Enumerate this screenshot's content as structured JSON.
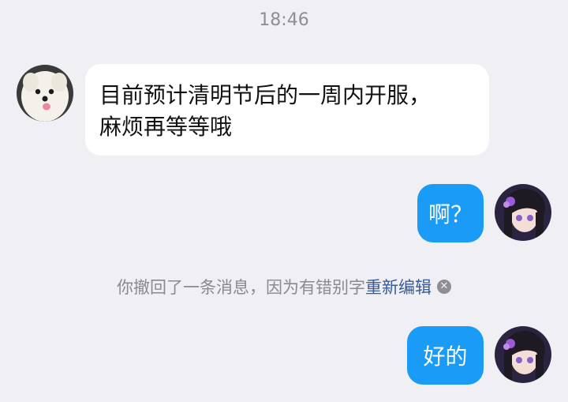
{
  "chat": {
    "timestamp": "18:46",
    "incoming_message": {
      "line1": "目前预计清明节后的一周内开服，",
      "line2": "麻烦再等等哦"
    },
    "outgoing_messages": [
      {
        "text": "啊？"
      },
      {
        "text": "好的"
      }
    ],
    "system_notice": {
      "text": "你撤回了一条消息，因为有错别字",
      "link": "重新编辑"
    }
  },
  "colors": {
    "background": "#efeff4",
    "incoming_bubble": "#ffffff",
    "outgoing_bubble": "#1a9bf5",
    "link": "#365b9a"
  },
  "icons": {
    "dismiss": "close-circle-icon"
  }
}
